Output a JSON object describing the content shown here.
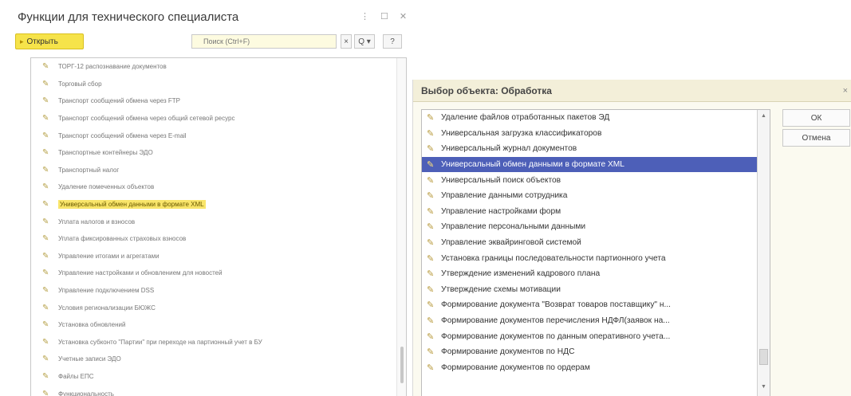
{
  "window1": {
    "title": "Функции для технического специалиста",
    "controls": [
      "⋮",
      "☐",
      "✕"
    ],
    "toolbar": {
      "open_label": "Открыть",
      "search_placeholder": "Поиск (Ctrl+F)",
      "clear_label": "×",
      "search_label": "Q ▾",
      "help_label": "?"
    },
    "items": [
      "ТОРГ-12 распознавание документов",
      "Торговый сбор",
      "Транспорт сообщений обмена через FTP",
      "Транспорт сообщений обмена через общий сетевой ресурс",
      "Транспорт сообщений обмена через E-mail",
      "Транспортные контейнеры ЭДО",
      "Транспортный налог",
      "Удаление помеченных объектов",
      "Универсальный обмен данными в формате XML",
      "Уплата налогов и взносов",
      "Уплата фиксированных страховых взносов",
      "Управление итогами и агрегатами",
      "Управление настройками и обновлением для новостей",
      "Управление подключением DSS",
      "Условия регионализации БЮЖС",
      "Установка обновлений",
      "Установка субконто \"Партии\" при переходе на партионный учет в БУ",
      "Учетные записи ЭДО",
      "Файлы ЕПС",
      "Функциональность"
    ],
    "selected_index": 8
  },
  "window2": {
    "title": "Выбор объекта: Обработка",
    "close": "×",
    "ok_label": "ОК",
    "cancel_label": "Отмена",
    "scroll_up": "▲",
    "scroll_down": "▼",
    "items": [
      "Удаление файлов отработанных пакетов ЭД",
      "Универсальная загрузка классификаторов",
      "Универсальный журнал документов",
      "Универсальный обмен данными в формате XML",
      "Универсальный поиск объектов",
      "Управление данными сотрудника",
      "Управление настройками форм",
      "Управление персональными данными",
      "Управление эквайринговой системой",
      "Установка границы последовательности партионного учета",
      "Утверждение изменений кадрового плана",
      "Утверждение схемы мотивации",
      "Формирование документа \"Возврат товаров поставщику\" н...",
      "Формирование документов перечисления НДФЛ(заявок на...",
      "Формирование документов по данным оперативного учета...",
      "Формирование документов по НДС",
      "Формирование документов по ордерам"
    ],
    "selected_index": 3
  },
  "colors": {
    "open_button": "#f6e34a",
    "selection_yellow": "#f9e56a",
    "selection_blue": "#4d5fb8",
    "dialog_title_bg": "#f3efd9"
  },
  "icons": {
    "list_item": "processing-icon"
  }
}
